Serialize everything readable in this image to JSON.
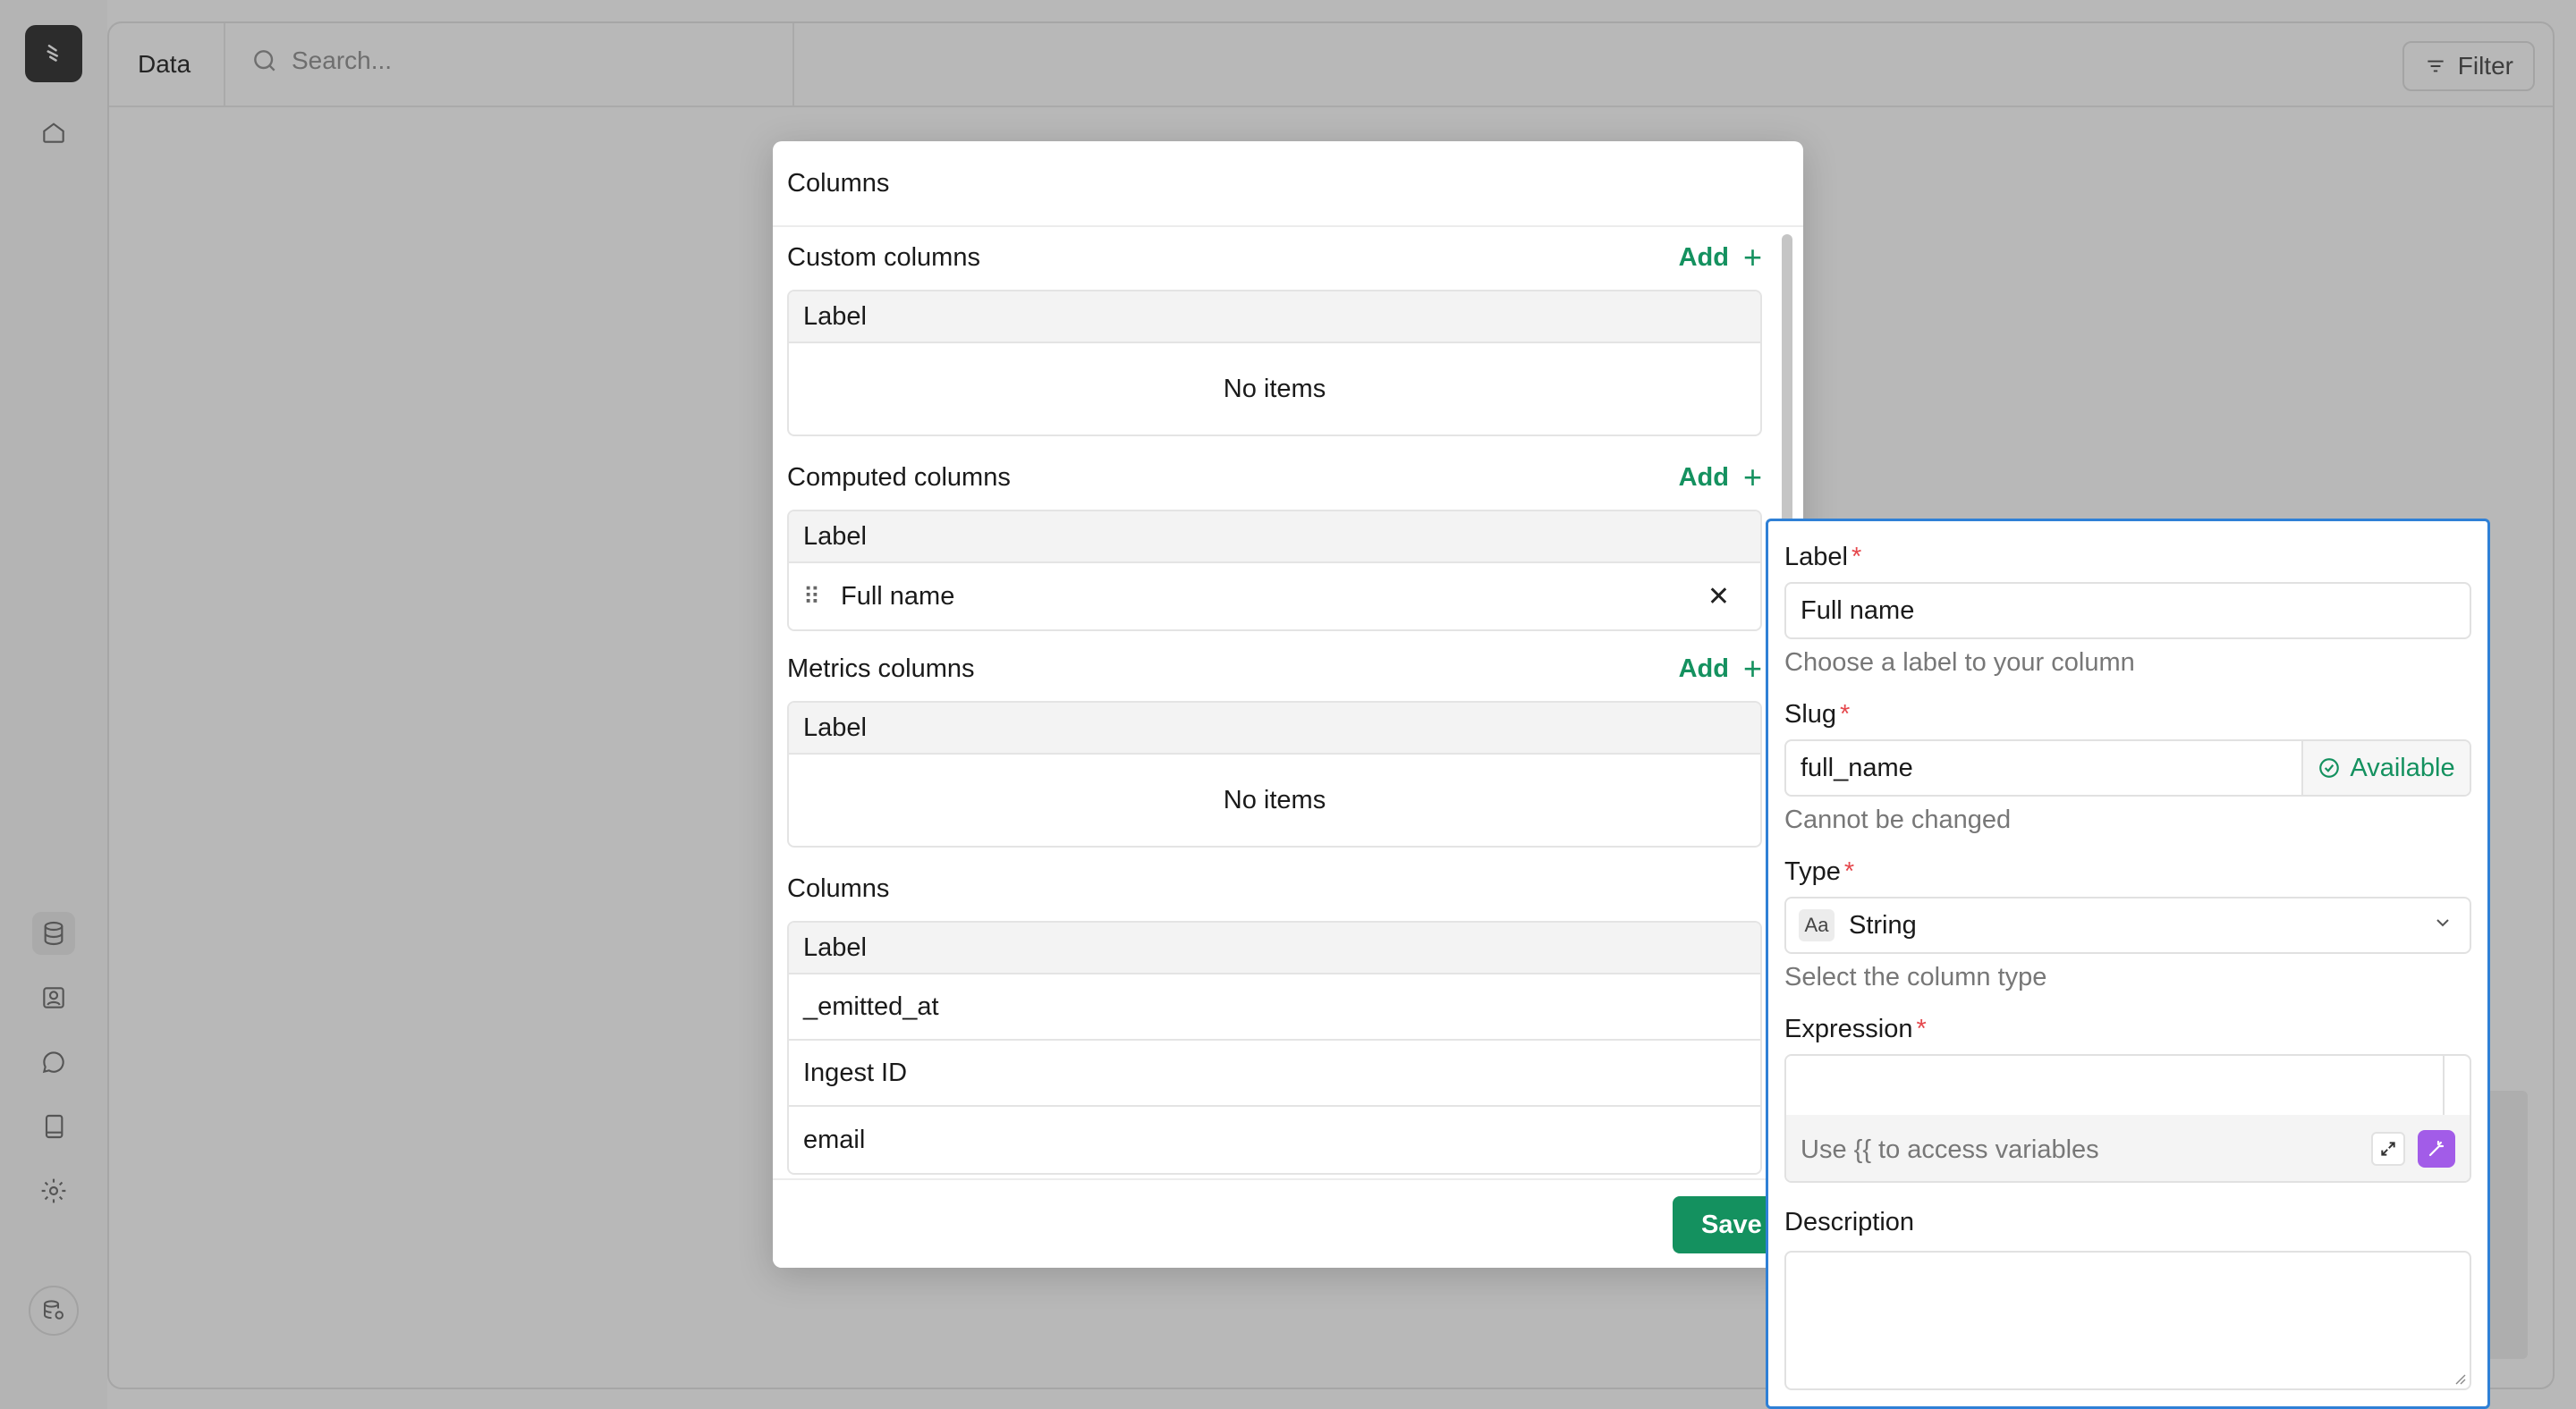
{
  "app": {
    "topbar": {
      "tab_label": "Data",
      "search_placeholder": "Search...",
      "filter_label": "Filter"
    },
    "rail": {
      "logo_icon": "app-logo-icon",
      "icons": [
        "home-icon",
        "database-icon",
        "contact-icon",
        "chat-icon",
        "book-icon",
        "settings-icon"
      ],
      "bottom_icon": "database-account-icon"
    }
  },
  "modal": {
    "title": "Columns",
    "add_label": "Add",
    "add_symbol": "+",
    "custom": {
      "title": "Custom columns",
      "header": "Label",
      "empty": "No items"
    },
    "computed": {
      "title": "Computed columns",
      "header": "Label",
      "rows": [
        {
          "label": "Full name",
          "drag_glyph": "⠿",
          "remove_glyph": "✕"
        }
      ]
    },
    "metrics": {
      "title": "Metrics columns",
      "header": "Label",
      "empty": "No items"
    },
    "columns": {
      "title": "Columns",
      "header": "Label",
      "rows": [
        "_emitted_at",
        "Ingest ID",
        "email"
      ]
    },
    "save_label": "Save"
  },
  "panel": {
    "label": {
      "label": "Label",
      "required_mark": "*",
      "value": "Full name",
      "hint": "Choose a label to your column"
    },
    "slug": {
      "label": "Slug",
      "required_mark": "*",
      "value": "full_name",
      "status": "Available",
      "hint": "Cannot be changed"
    },
    "type": {
      "label": "Type",
      "required_mark": "*",
      "badge": "Aa",
      "value": "String",
      "hint": "Select the column type"
    },
    "expression": {
      "label": "Expression",
      "required_mark": "*",
      "value": "",
      "helper": "Use {{ to access variables"
    },
    "description": {
      "label": "Description",
      "value": ""
    }
  },
  "colors": {
    "accent_green": "#14915f",
    "focus_blue": "#2f80d6",
    "required_red": "#e5484d",
    "ai_purple": "#a25ce8"
  }
}
